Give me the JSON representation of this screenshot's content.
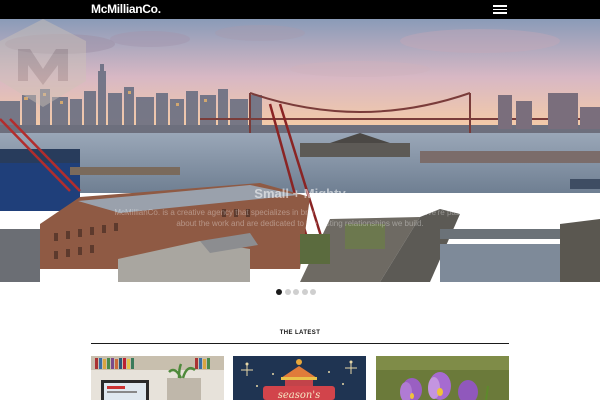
{
  "header": {
    "logo_text": "McMillianCo.",
    "menu_icon": "hamburger-menu-icon",
    "background": "#000000"
  },
  "hero": {
    "headline": "Small + Mighty",
    "body": "McMillianCo. is a creative agency that specializes in branding and interactive solutions. We're passionate about the work and are dedicated to the lasting relationships we build.",
    "slides_total": 5,
    "active_slide": 1
  },
  "latest": {
    "heading": "THE LATEST",
    "cards": [
      {
        "name": "card-office-workspace"
      },
      {
        "name": "card-seasons-greetings",
        "visible_text": "season's"
      },
      {
        "name": "card-crocus-flowers"
      }
    ]
  }
}
